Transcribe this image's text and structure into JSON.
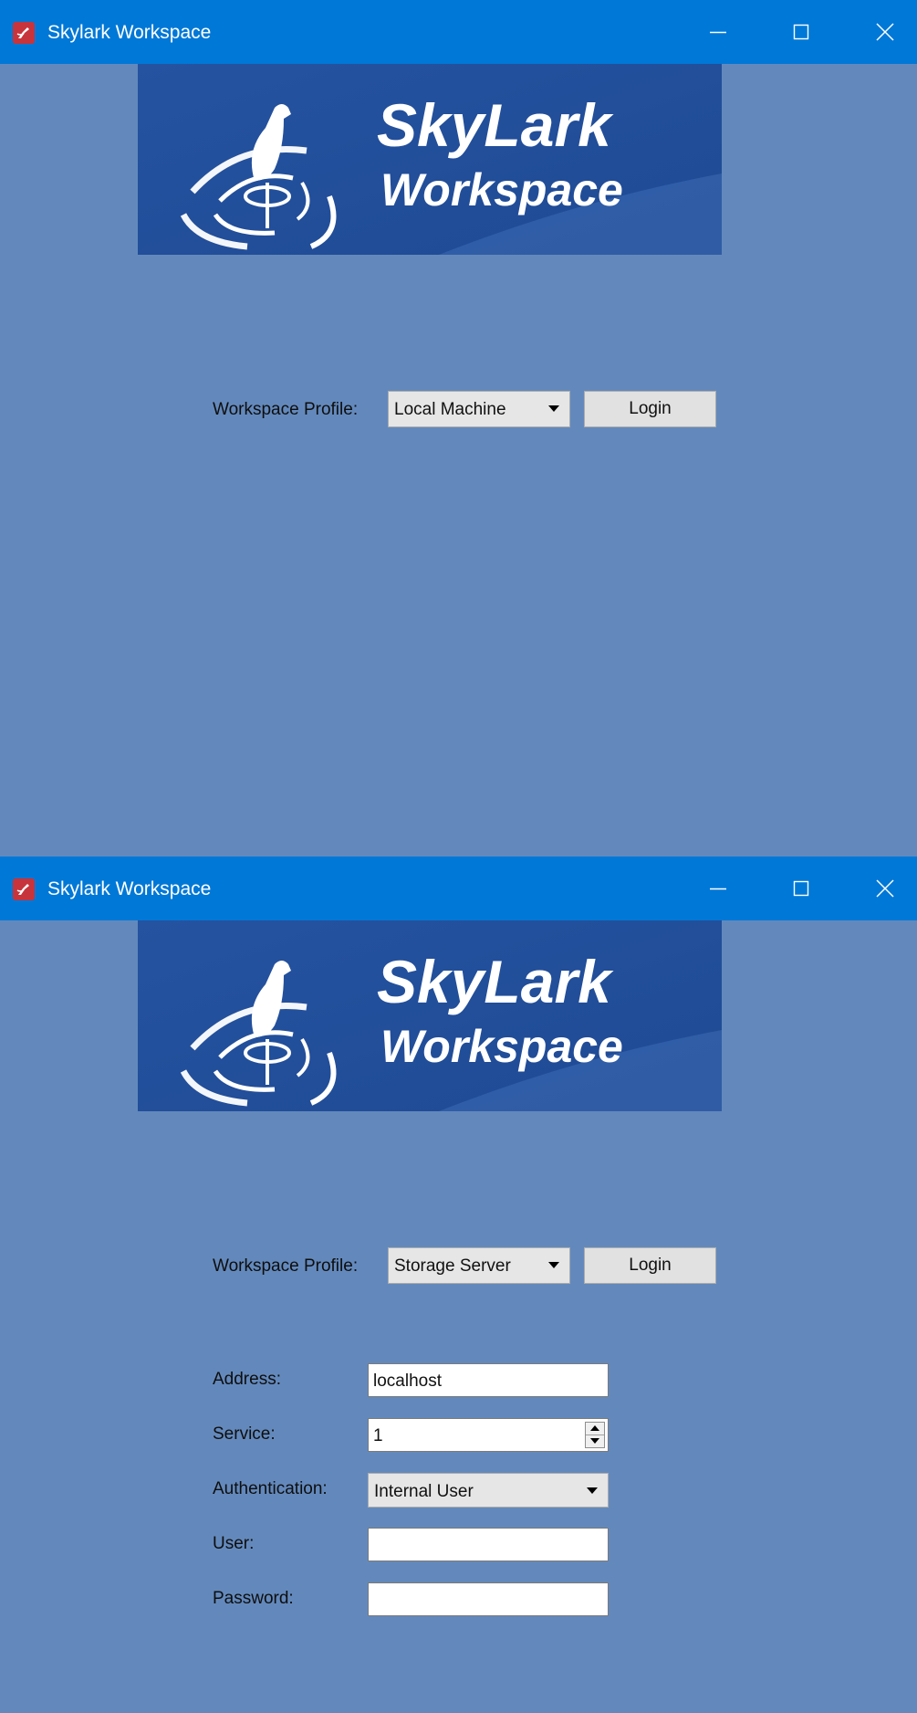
{
  "window1": {
    "title": "Skylark Workspace",
    "banner": {
      "line1": "SkyLark",
      "line2": "Workspace"
    },
    "profile_label": "Workspace Profile:",
    "profile_value": "Local Machine",
    "login_label": "Login"
  },
  "window2": {
    "title": "Skylark Workspace",
    "banner": {
      "line1": "SkyLark",
      "line2": "Workspace"
    },
    "profile_label": "Workspace Profile:",
    "profile_value": "Storage Server",
    "login_label": "Login",
    "form": {
      "address_label": "Address:",
      "address_value": "localhost",
      "service_label": "Service:",
      "service_value": "1",
      "authentication_label": "Authentication:",
      "authentication_value": "Internal User",
      "user_label": "User:",
      "user_value": "",
      "password_label": "Password:",
      "password_value": ""
    }
  },
  "icons": {
    "app": "skylark-bird-icon",
    "minimize": "minimize-icon",
    "maximize": "maximize-icon",
    "close": "close-icon",
    "dropdown": "chevron-down-icon",
    "spin_up": "spin-up-icon",
    "spin_down": "spin-down-icon"
  },
  "colors": {
    "titlebar": "#0078d7",
    "background": "#6389bc",
    "banner": "#2553a0",
    "app_icon": "#c8343b"
  }
}
